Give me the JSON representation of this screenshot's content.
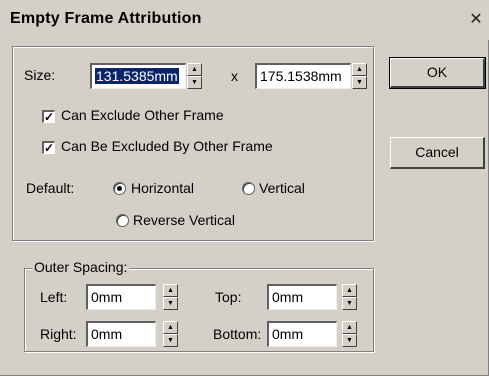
{
  "window": {
    "title": "Empty Frame Attribution",
    "close_glyph": "✕"
  },
  "frame": {
    "size_label": "Size:",
    "width_value": "131.5385mm",
    "times_symbol": "x",
    "height_value": "175.1538mm",
    "can_exclude_label": "Can Exclude Other Frame",
    "can_exclude_checked": true,
    "can_be_excluded_label": "Can Be Excluded By Other Frame",
    "can_be_excluded_checked": true,
    "default_label": "Default:",
    "orientation_options": [
      "Horizontal",
      "Vertical",
      "Reverse Vertical"
    ],
    "orientation_selected": "Horizontal",
    "check_glyph": "✓"
  },
  "outer_spacing": {
    "title": "Outer Spacing:",
    "left_label": "Left:",
    "left_value": "0mm",
    "top_label": "Top:",
    "top_value": "0mm",
    "right_label": "Right:",
    "right_value": "0mm",
    "bottom_label": "Bottom:",
    "bottom_value": "0mm"
  },
  "buttons": {
    "ok": "OK",
    "cancel": "Cancel"
  },
  "spin_glyphs": {
    "up": "▲",
    "down": "▼"
  }
}
